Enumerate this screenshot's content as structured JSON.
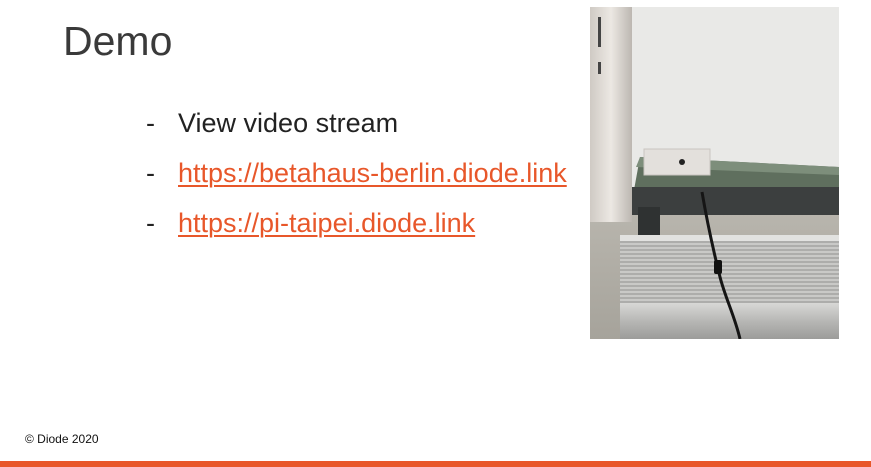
{
  "slide": {
    "title": "Demo",
    "bullets": [
      {
        "dash": "-",
        "text": "View video stream",
        "is_link": false
      },
      {
        "dash": "-",
        "text": "https://betahaus-berlin.diode.link",
        "is_link": true
      },
      {
        "dash": "-",
        "text": "https://pi-taipei.diode.link",
        "is_link": true
      }
    ],
    "footer": "© Diode 2020"
  },
  "colors": {
    "accent": "#e8572a",
    "text": "#222222",
    "title": "#3a3a3a"
  }
}
